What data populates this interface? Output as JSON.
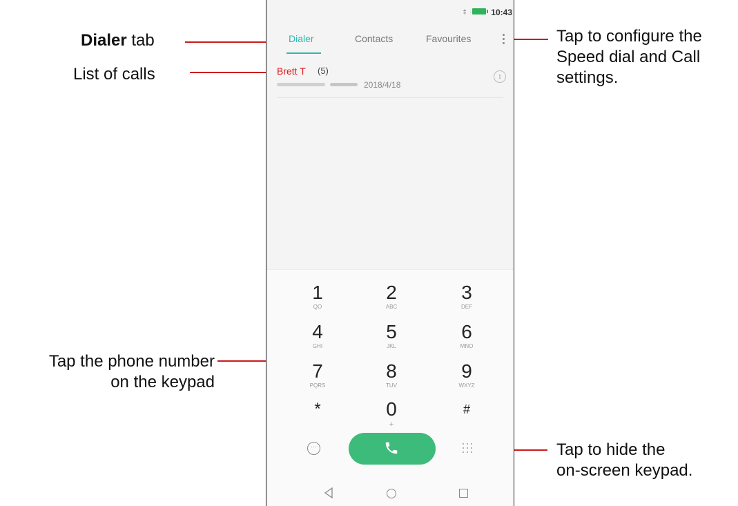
{
  "status_bar": {
    "time": "10:43",
    "signal_text": "‡ ·íˡ"
  },
  "tabs": [
    {
      "label": "Dialer",
      "active": true
    },
    {
      "label": "Contacts",
      "active": false
    },
    {
      "label": "Favourites",
      "active": false
    }
  ],
  "call_log": {
    "name": "Brett T",
    "count": "(5)",
    "date": "2018/4/18"
  },
  "keypad": {
    "keys": [
      {
        "digit": "1",
        "letters": "QO"
      },
      {
        "digit": "2",
        "letters": "ABC"
      },
      {
        "digit": "3",
        "letters": "DEF"
      },
      {
        "digit": "4",
        "letters": "GHI"
      },
      {
        "digit": "5",
        "letters": "JKL"
      },
      {
        "digit": "6",
        "letters": "MNO"
      },
      {
        "digit": "7",
        "letters": "PQRS"
      },
      {
        "digit": "8",
        "letters": "TUV"
      },
      {
        "digit": "9",
        "letters": "WXYZ"
      },
      {
        "digit": "*",
        "letters": ""
      },
      {
        "digit": "0",
        "letters": "+"
      },
      {
        "digit": "#",
        "letters": ""
      }
    ]
  },
  "colors": {
    "accent": "#2ab9b0",
    "call_green": "#3dbb7a",
    "annotation_red": "#cc1a1a",
    "contact_red": "#e0161b"
  },
  "annotations": {
    "dialer_bold": "Dialer",
    "dialer_rest": " tab",
    "list_of_calls": "List of calls",
    "keypad_line1": "Tap the phone number",
    "keypad_line2": "on the keypad",
    "settings_line1": "Tap to configure the",
    "settings_line2": "Speed dial and Call",
    "settings_line3": "settings.",
    "hide_line1": "Tap to hide the",
    "hide_line2": "on-screen keypad."
  }
}
